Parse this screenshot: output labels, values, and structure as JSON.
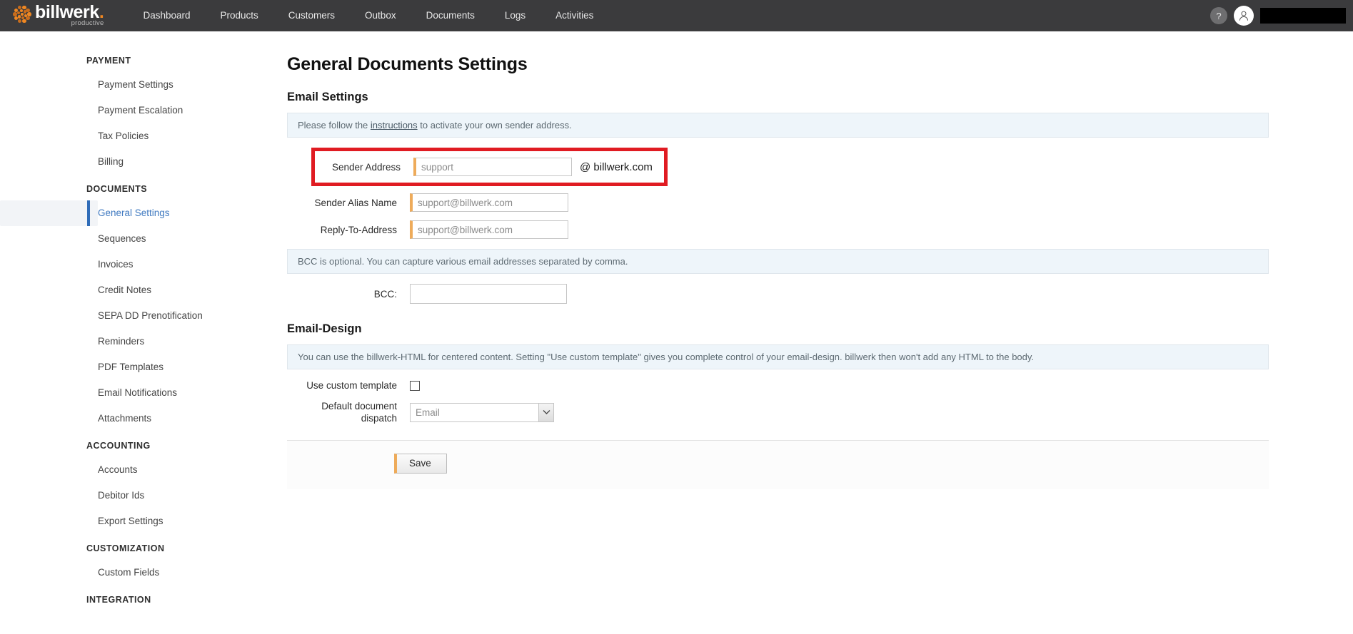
{
  "navbar": {
    "brand": {
      "name": "billwerk",
      "dot": ".",
      "subtitle": "productive"
    },
    "links": [
      {
        "label": "Dashboard"
      },
      {
        "label": "Products"
      },
      {
        "label": "Customers"
      },
      {
        "label": "Outbox"
      },
      {
        "label": "Documents"
      },
      {
        "label": "Logs"
      },
      {
        "label": "Activities"
      }
    ],
    "help_label": "?",
    "account_redacted": ""
  },
  "sidebar": {
    "groups": [
      {
        "title": "PAYMENT",
        "items": [
          {
            "label": "Payment Settings",
            "active": false
          },
          {
            "label": "Payment Escalation",
            "active": false
          },
          {
            "label": "Tax Policies",
            "active": false
          },
          {
            "label": "Billing",
            "active": false
          }
        ]
      },
      {
        "title": "DOCUMENTS",
        "items": [
          {
            "label": "General Settings",
            "active": true
          },
          {
            "label": "Sequences",
            "active": false
          },
          {
            "label": "Invoices",
            "active": false
          },
          {
            "label": "Credit Notes",
            "active": false
          },
          {
            "label": "SEPA DD Prenotification",
            "active": false
          },
          {
            "label": "Reminders",
            "active": false
          },
          {
            "label": "PDF Templates",
            "active": false
          },
          {
            "label": "Email Notifications",
            "active": false
          },
          {
            "label": "Attachments",
            "active": false
          }
        ]
      },
      {
        "title": "ACCOUNTING",
        "items": [
          {
            "label": "Accounts",
            "active": false
          },
          {
            "label": "Debitor Ids",
            "active": false
          },
          {
            "label": "Export Settings",
            "active": false
          }
        ]
      },
      {
        "title": "CUSTOMIZATION",
        "items": [
          {
            "label": "Custom Fields",
            "active": false
          }
        ]
      },
      {
        "title": "INTEGRATION",
        "items": []
      }
    ]
  },
  "main": {
    "page_title": "General Documents Settings",
    "email_settings": {
      "heading": "Email Settings",
      "banner_before": "Please follow the ",
      "banner_link": "instructions",
      "banner_after": " to activate your own sender address.",
      "sender_address_label": "Sender Address",
      "sender_address_value": "support",
      "sender_address_domain": "@ billwerk.com",
      "sender_alias_label": "Sender Alias Name",
      "sender_alias_value": "support@billwerk.com",
      "reply_to_label": "Reply-To-Address",
      "reply_to_value": "support@billwerk.com",
      "bcc_banner": "BCC is optional. You can capture various email addresses separated by comma.",
      "bcc_label": "BCC:",
      "bcc_value": ""
    },
    "email_design": {
      "heading": "Email-Design",
      "banner": "You can use the billwerk-HTML for centered content. Setting \"Use custom template\" gives you complete control of your email-design. billwerk then won't add any HTML to the body.",
      "custom_template_label": "Use custom template",
      "custom_template_checked": false,
      "dispatch_label_line1": "Default document",
      "dispatch_label_line2": "dispatch",
      "dispatch_value": "Email",
      "dispatch_options": [
        "Email"
      ]
    },
    "save_label": "Save"
  },
  "colors": {
    "navbar_bg": "#3b3b3d",
    "brand_orange": "#ef8722",
    "accent_orange": "#eeab5a",
    "active_blue": "#2f6cb8",
    "highlight_red": "#e01b22",
    "banner_bg": "#eef5fa"
  }
}
